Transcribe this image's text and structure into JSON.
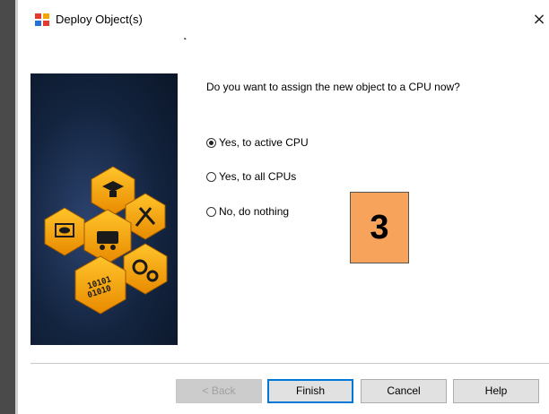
{
  "window": {
    "title": "Deploy Object(s)",
    "close_glyph": "×"
  },
  "content": {
    "question": "Do you want to assign the new object to a CPU now?",
    "options": [
      {
        "label": "Yes, to active CPU",
        "checked": true
      },
      {
        "label": "Yes, to all CPUs",
        "checked": false
      },
      {
        "label": "No, do nothing",
        "checked": false
      }
    ],
    "badge_label": "3",
    "badge_color": "#f7a35c"
  },
  "buttons": {
    "back": "< Back",
    "finish": "Finish",
    "cancel": "Cancel",
    "help": "Help"
  },
  "banner": {
    "tile_color": "#f5a300",
    "background": "#13243f",
    "tile_text": "10101\n01010"
  }
}
